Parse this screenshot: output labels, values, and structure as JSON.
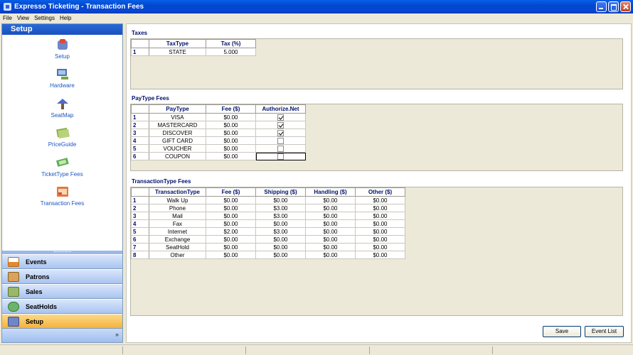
{
  "window": {
    "title": "Expresso Ticketing - Transaction Fees"
  },
  "menu": [
    "File",
    "View",
    "Settings",
    "Help"
  ],
  "sidebar": {
    "header": "Setup",
    "tools": [
      {
        "label": "Setup",
        "icon": "setup-icon"
      },
      {
        "label": "Hardware",
        "icon": "hardware-icon"
      },
      {
        "label": "SeatMap",
        "icon": "seatmap-icon"
      },
      {
        "label": "PriceGuide",
        "icon": "priceguide-icon"
      },
      {
        "label": "TicketType Fees",
        "icon": "tickettype-fees-icon"
      },
      {
        "label": "Transaction Fees",
        "icon": "transaction-fees-icon"
      }
    ],
    "nav": [
      {
        "label": "Events",
        "icon": "calendar-icon",
        "active": false
      },
      {
        "label": "Patrons",
        "icon": "patrons-icon",
        "active": false
      },
      {
        "label": "Sales",
        "icon": "cart-icon",
        "active": false
      },
      {
        "label": "SeatHolds",
        "icon": "seatholds-icon",
        "active": false
      },
      {
        "label": "Setup",
        "icon": "setup-icon",
        "active": true
      }
    ],
    "expand": "»"
  },
  "taxes": {
    "title": "Taxes",
    "columns": [
      "TaxType",
      "Tax (%)"
    ],
    "rows": [
      {
        "n": "1",
        "cells": [
          "STATE",
          "5.000"
        ]
      }
    ]
  },
  "paytype": {
    "title": "PayType Fees",
    "columns": [
      "PayType",
      "Fee ($)",
      "Authorize.Net"
    ],
    "rows": [
      {
        "n": "1",
        "paytype": "VISA",
        "fee": "$0.00",
        "authorize": true
      },
      {
        "n": "2",
        "paytype": "MASTERCARD",
        "fee": "$0.00",
        "authorize": true
      },
      {
        "n": "3",
        "paytype": "DISCOVER",
        "fee": "$0.00",
        "authorize": true
      },
      {
        "n": "4",
        "paytype": "GIFT CARD",
        "fee": "$0.00",
        "authorize": false
      },
      {
        "n": "5",
        "paytype": "VOUCHER",
        "fee": "$0.00",
        "authorize": false
      },
      {
        "n": "6",
        "paytype": "COUPON",
        "fee": "$0.00",
        "authorize": false
      }
    ]
  },
  "transtype": {
    "title": "TransactionType Fees",
    "columns": [
      "TransactionType",
      "Fee ($)",
      "Shipping ($)",
      "Handling ($)",
      "Other ($)"
    ],
    "rows": [
      {
        "n": "1",
        "cells": [
          "Walk Up",
          "$0.00",
          "$0.00",
          "$0.00",
          "$0.00"
        ]
      },
      {
        "n": "2",
        "cells": [
          "Phone",
          "$0.00",
          "$3.00",
          "$0.00",
          "$0.00"
        ]
      },
      {
        "n": "3",
        "cells": [
          "Mail",
          "$0.00",
          "$3.00",
          "$0.00",
          "$0.00"
        ]
      },
      {
        "n": "4",
        "cells": [
          "Fax",
          "$0.00",
          "$0.00",
          "$0.00",
          "$0.00"
        ]
      },
      {
        "n": "5",
        "cells": [
          "Internet",
          "$2.00",
          "$3.00",
          "$0.00",
          "$0.00"
        ]
      },
      {
        "n": "6",
        "cells": [
          "Exchange",
          "$0.00",
          "$0.00",
          "$0.00",
          "$0.00"
        ]
      },
      {
        "n": "7",
        "cells": [
          "SeatHold",
          "$0.00",
          "$0.00",
          "$0.00",
          "$0.00"
        ]
      },
      {
        "n": "8",
        "cells": [
          "Other",
          "$0.00",
          "$0.00",
          "$0.00",
          "$0.00"
        ]
      }
    ]
  },
  "buttons": {
    "save": "Save",
    "event_list": "Event List"
  }
}
